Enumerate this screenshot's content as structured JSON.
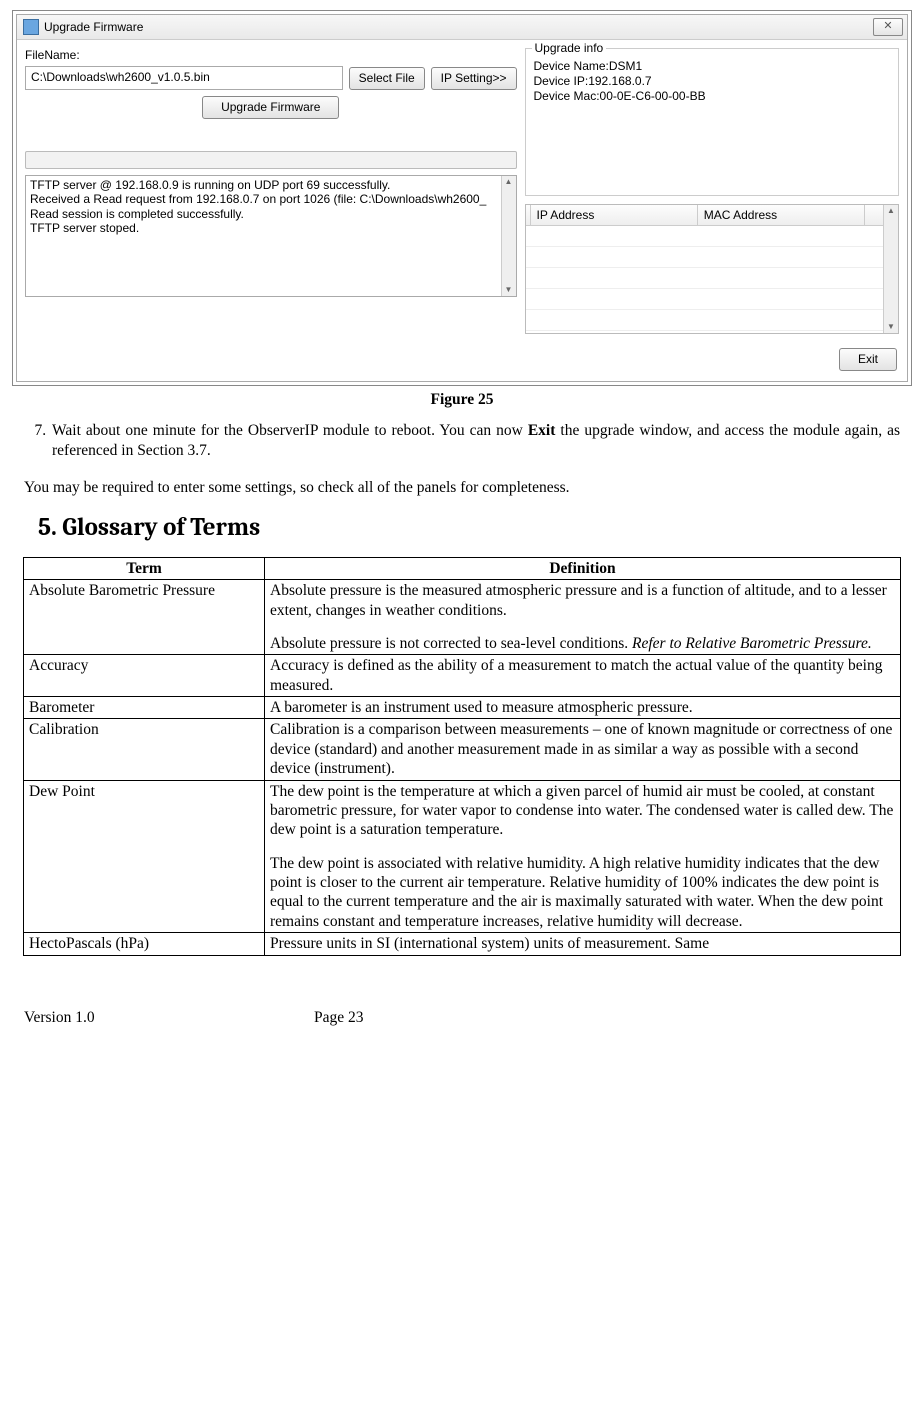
{
  "window": {
    "title": "Upgrade Firmware",
    "filename_label": "FileName:",
    "filename_value": "C:\\Downloads\\wh2600_v1.0.5.bin",
    "select_file_btn": "Select File",
    "ip_setting_btn": "IP Setting>>",
    "upgrade_btn": "Upgrade Firmware",
    "log_l1": "TFTP server @ 192.168.0.9 is running on UDP port 69 successfully.",
    "log_l2": "Received a Read request from 192.168.0.7 on port 1026 (file: C:\\Downloads\\wh2600_",
    "log_l3": "Read session is completed successfully.",
    "log_l4": "TFTP server stoped.",
    "upgrade_info_legend": "Upgrade info",
    "info_l1": "Device Name:DSM1",
    "info_l2": "Device IP:192.168.0.7",
    "info_l3": "Device Mac:00-0E-C6-00-00-BB",
    "grid_ip": "IP Address",
    "grid_mac": "MAC Address",
    "exit_btn": "Exit"
  },
  "figure_caption": "Figure 25",
  "list_item_7": "Wait about one minute for the ObserverIP module to reboot. You can now Exit the upgrade window, and access the module again, as referenced in Section 3.7.",
  "list_item_7_pre": "Wait about one minute for the ObserverIP module to reboot. You can now ",
  "list_item_7_bold": "Exit",
  "list_item_7_post": " the upgrade window, and access the module again, as referenced in Section 3.7.",
  "para_after": "You may be required to enter some settings, so check all of the panels for completeness.",
  "glossary_heading": "5. Glossary of Terms",
  "table": {
    "h_term": "Term",
    "h_def": "Definition",
    "r1_term": "Absolute Barometric Pressure",
    "r1_def_p1": "Absolute pressure is the measured atmospheric pressure and is a function of altitude, and to a lesser extent, changes in weather conditions.",
    "r1_def_p2a": "Absolute pressure is not corrected to sea-level conditions. ",
    "r1_def_p2b": "Refer to Relative Barometric Pressure.",
    "r2_term": "Accuracy",
    "r2_def": "Accuracy is defined as the ability of a measurement to match the actual value of the quantity being measured.",
    "r3_term": "Barometer",
    "r3_def": "A barometer is an instrument used to measure atmospheric pressure.",
    "r4_term": "Calibration",
    "r4_def": "Calibration is a comparison between measurements – one of known magnitude or correctness of one device (standard) and another measurement made in as similar a way as possible with a second device (instrument).",
    "r5_term": "Dew Point",
    "r5_def_p1": "The dew point is the temperature at which a given parcel of humid air must be cooled, at constant barometric pressure, for water vapor to condense into water. The condensed water is called dew. The dew point is a saturation temperature.",
    "r5_def_p2": "The dew point is associated with relative humidity. A high relative humidity indicates that the dew point is closer to the current air temperature. Relative humidity of 100% indicates the dew point is equal to the current temperature and the air is maximally saturated with water. When the dew point remains constant and temperature increases, relative humidity will decrease.",
    "r6_term": "HectoPascals (hPa)",
    "r6_def": "Pressure units in SI (international system) units of measurement. Same"
  },
  "footer": {
    "version": "Version 1.0",
    "page": "Page 23"
  }
}
